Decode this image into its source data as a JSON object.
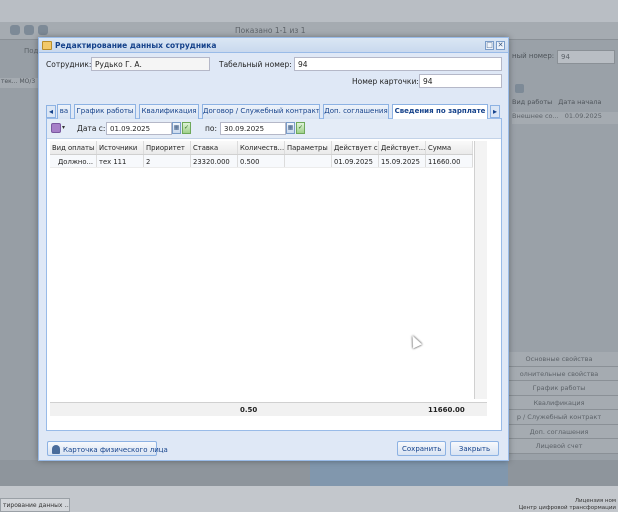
{
  "background": {
    "shown": "Показано 1-1 из 1",
    "left_label": "Подр",
    "left_row": "тек... МО/3",
    "tab_number_label": "ный номер:",
    "tab_number_value": "94",
    "grid_headers": [
      "Вид работы",
      "Дата начала"
    ],
    "grid_row": [
      "Внешнее со...",
      "01.09.2025"
    ],
    "accordion": [
      "Основные свойства",
      "олнительные свойства",
      "График работы",
      "Квалификация",
      "р / Служебный контракт",
      "Доп. соглашения",
      "Лицевой счет"
    ],
    "taskbar_item": "тирование данных ...",
    "license_line1": "Лицензия ном",
    "license_line2": "Центр цифровой трансформации"
  },
  "dialog": {
    "title": "Редактирование данных сотрудника",
    "employee_label": "Сотрудник:",
    "employee_value": "Рудько Г. А.",
    "tab_number_label": "Табельный номер:",
    "tab_number_value": "94",
    "card_number_label": "Номер карточки:",
    "card_number_value": "94",
    "tabs": [
      "ва",
      "График работы",
      "Квалификация",
      "Договор / Служебный контракт",
      "Доп. соглашения",
      "Сведения по зарплате"
    ],
    "active_tab": "Сведения по зарплате",
    "filter": {
      "date_from_label": "Дата с:",
      "date_from": "01.09.2025",
      "date_to_label": "по:",
      "date_to": "30.09.2025"
    },
    "grid": {
      "columns": [
        "Вид оплаты",
        "Источники",
        "Приоритет",
        "Ставка",
        "Количеств...",
        "Параметры",
        "Действует с",
        "Действует...",
        "Сумма"
      ],
      "rows": [
        [
          "Должно...",
          "тех 111",
          "2",
          "23320.000",
          "0.500",
          "",
          "01.09.2025",
          "15.09.2025",
          "11660.00"
        ]
      ],
      "summary_quantity": "0.50",
      "summary_sum": "11660.00"
    },
    "buttons": {
      "person_card": "Карточка физического лица",
      "save": "Сохранить",
      "close": "Закрыть"
    }
  }
}
